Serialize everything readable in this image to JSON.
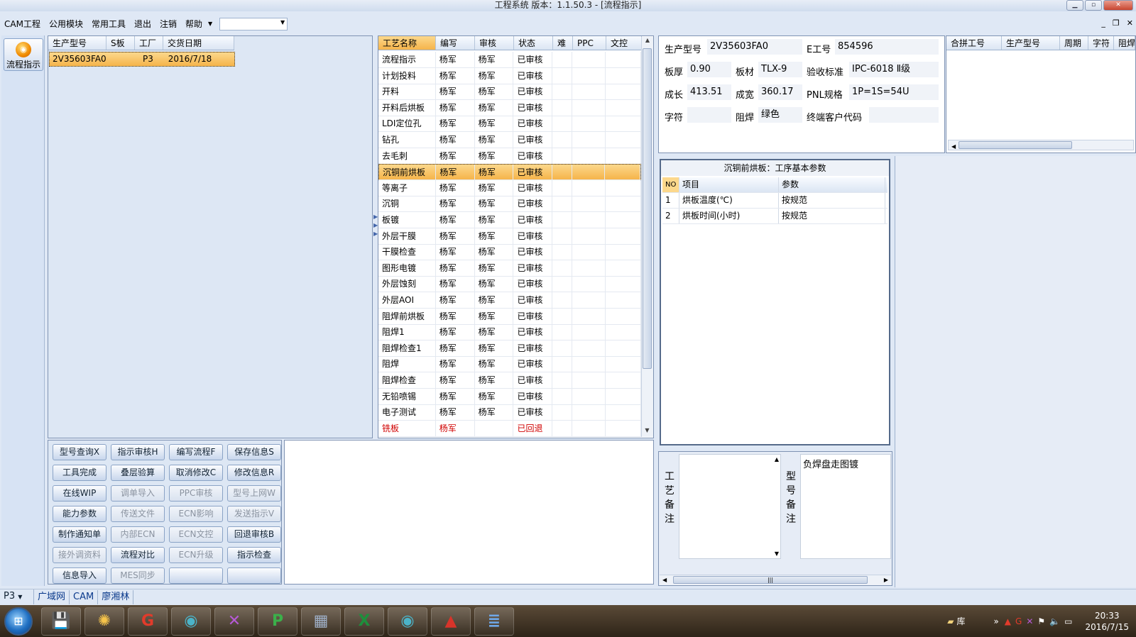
{
  "window": {
    "title": "工程系统    版本：1.1.50.3 - [流程指示]",
    "buttons": [
      "▁",
      "▫",
      "✕"
    ]
  },
  "menubar": {
    "items": [
      "CAM工程",
      "公用模块",
      "常用工具",
      "退出",
      "注销",
      "帮助"
    ],
    "combo_value": ""
  },
  "mdi_controls": [
    "_",
    "❐",
    "✕"
  ],
  "leftnav": {
    "flow_button": "流程指示"
  },
  "job_grid": {
    "headers": [
      "生产型号",
      "S板",
      "工厂",
      "交货日期"
    ],
    "rows": [
      {
        "model": "2V35603FA0",
        "s": "",
        "factory": "P3",
        "date": "2016/7/18"
      }
    ]
  },
  "process_grid": {
    "headers": [
      "工艺名称",
      "编写",
      "审核",
      "状态",
      "难",
      "PPC",
      "文控"
    ],
    "rows": [
      {
        "name": "流程指示",
        "writer": "杨军",
        "reviewer": "杨军",
        "status": "已审核"
      },
      {
        "name": "计划投料",
        "writer": "杨军",
        "reviewer": "杨军",
        "status": "已审核"
      },
      {
        "name": "开料",
        "writer": "杨军",
        "reviewer": "杨军",
        "status": "已审核"
      },
      {
        "name": "开料后烘板",
        "writer": "杨军",
        "reviewer": "杨军",
        "status": "已审核"
      },
      {
        "name": "LDI定位孔",
        "writer": "杨军",
        "reviewer": "杨军",
        "status": "已审核"
      },
      {
        "name": "钻孔",
        "writer": "杨军",
        "reviewer": "杨军",
        "status": "已审核"
      },
      {
        "name": "去毛刺",
        "writer": "杨军",
        "reviewer": "杨军",
        "status": "已审核"
      },
      {
        "name": "沉铜前烘板",
        "writer": "杨军",
        "reviewer": "杨军",
        "status": "已审核"
      },
      {
        "name": "等离子",
        "writer": "杨军",
        "reviewer": "杨军",
        "status": "已审核"
      },
      {
        "name": "沉铜",
        "writer": "杨军",
        "reviewer": "杨军",
        "status": "已审核"
      },
      {
        "name": "板镀",
        "writer": "杨军",
        "reviewer": "杨军",
        "status": "已审核"
      },
      {
        "name": "外层干膜",
        "writer": "杨军",
        "reviewer": "杨军",
        "status": "已审核"
      },
      {
        "name": "干膜检查",
        "writer": "杨军",
        "reviewer": "杨军",
        "status": "已审核"
      },
      {
        "name": "图形电镀",
        "writer": "杨军",
        "reviewer": "杨军",
        "status": "已审核"
      },
      {
        "name": "外层蚀刻",
        "writer": "杨军",
        "reviewer": "杨军",
        "status": "已审核"
      },
      {
        "name": "外层AOI",
        "writer": "杨军",
        "reviewer": "杨军",
        "status": "已审核"
      },
      {
        "name": "阻焊前烘板",
        "writer": "杨军",
        "reviewer": "杨军",
        "status": "已审核"
      },
      {
        "name": "阻焊1",
        "writer": "杨军",
        "reviewer": "杨军",
        "status": "已审核"
      },
      {
        "name": "阻焊检查1",
        "writer": "杨军",
        "reviewer": "杨军",
        "status": "已审核"
      },
      {
        "name": "阻焊",
        "writer": "杨军",
        "reviewer": "杨军",
        "status": "已审核"
      },
      {
        "name": "阻焊检查",
        "writer": "杨军",
        "reviewer": "杨军",
        "status": "已审核"
      },
      {
        "name": "无铅喷锡",
        "writer": "杨军",
        "reviewer": "杨军",
        "status": "已审核"
      },
      {
        "name": "电子测试",
        "writer": "杨军",
        "reviewer": "杨军",
        "status": "已审核"
      },
      {
        "name": "铣板",
        "writer": "杨军",
        "reviewer": "",
        "status": "已回退"
      }
    ],
    "selected_index": 7
  },
  "buttons": [
    {
      "label": "型号查询X",
      "enabled": true
    },
    {
      "label": "指示审核H",
      "enabled": true
    },
    {
      "label": "编写流程F",
      "enabled": true
    },
    {
      "label": "保存信息S",
      "enabled": true
    },
    {
      "label": "工具完成",
      "enabled": true
    },
    {
      "label": "叠层验算",
      "enabled": true
    },
    {
      "label": "取消修改C",
      "enabled": true
    },
    {
      "label": "修改信息R",
      "enabled": true
    },
    {
      "label": "在线WIP",
      "enabled": true
    },
    {
      "label": "调单导入",
      "enabled": false
    },
    {
      "label": "PPC审核",
      "enabled": false
    },
    {
      "label": "型号上网W",
      "enabled": false
    },
    {
      "label": "能力参数",
      "enabled": true
    },
    {
      "label": "传送文件",
      "enabled": false
    },
    {
      "label": "ECN影响",
      "enabled": false
    },
    {
      "label": "发送指示V",
      "enabled": false
    },
    {
      "label": "制作通知单",
      "enabled": true
    },
    {
      "label": "内部ECN",
      "enabled": false
    },
    {
      "label": "ECN文控",
      "enabled": false
    },
    {
      "label": "回退审核B",
      "enabled": true
    },
    {
      "label": "接外调资料",
      "enabled": false
    },
    {
      "label": "流程对比",
      "enabled": true
    },
    {
      "label": "ECN升级",
      "enabled": false
    },
    {
      "label": "指示检查",
      "enabled": true
    },
    {
      "label": "信息导入",
      "enabled": true
    },
    {
      "label": "MES同步",
      "enabled": false
    },
    {
      "label": "",
      "enabled": true
    },
    {
      "label": "",
      "enabled": true
    }
  ],
  "info": {
    "model_label": "生产型号",
    "model": "2V35603FA0",
    "ework_label": "E工号",
    "ework": "854596",
    "thickness_label": "板厚",
    "thickness": "0.90",
    "material_label": "板材",
    "material": "TLX-9",
    "standard_label": "验收标准",
    "standard": "IPC-6018 Ⅱ级",
    "length_label": "成长",
    "length": "413.51",
    "width_label": "成宽",
    "width": "360.17",
    "pnl_label": "PNL规格",
    "pnl": "1P=1S=54U",
    "char_label": "字符",
    "char": "",
    "mask_label": "阻焊",
    "mask": "绿色",
    "customer_label": "终端客户代码",
    "customer": ""
  },
  "merge_grid": {
    "headers": [
      "合拼工号",
      "生产型号",
      "周期",
      "字符",
      "阻焊"
    ]
  },
  "params": {
    "title": "沉铜前烘板：工序基本参数",
    "headers": [
      "NO",
      "项目",
      "参数"
    ],
    "rows": [
      {
        "no": "1",
        "item": "烘板温度(℃)",
        "value": "按规范"
      },
      {
        "no": "2",
        "item": "烘板时间(小时)",
        "value": "按规范"
      }
    ]
  },
  "remarks": {
    "craft_label": "工艺备注",
    "model_label": "型号备注",
    "craft_text": "",
    "model_text": "负焊盘走图镀"
  },
  "statusbar": [
    "P3",
    "广域网",
    "CAM",
    "廖湘林"
  ],
  "taskbar": {
    "tray_folder": "库",
    "time": "20:33",
    "date": "2016/7/15"
  }
}
